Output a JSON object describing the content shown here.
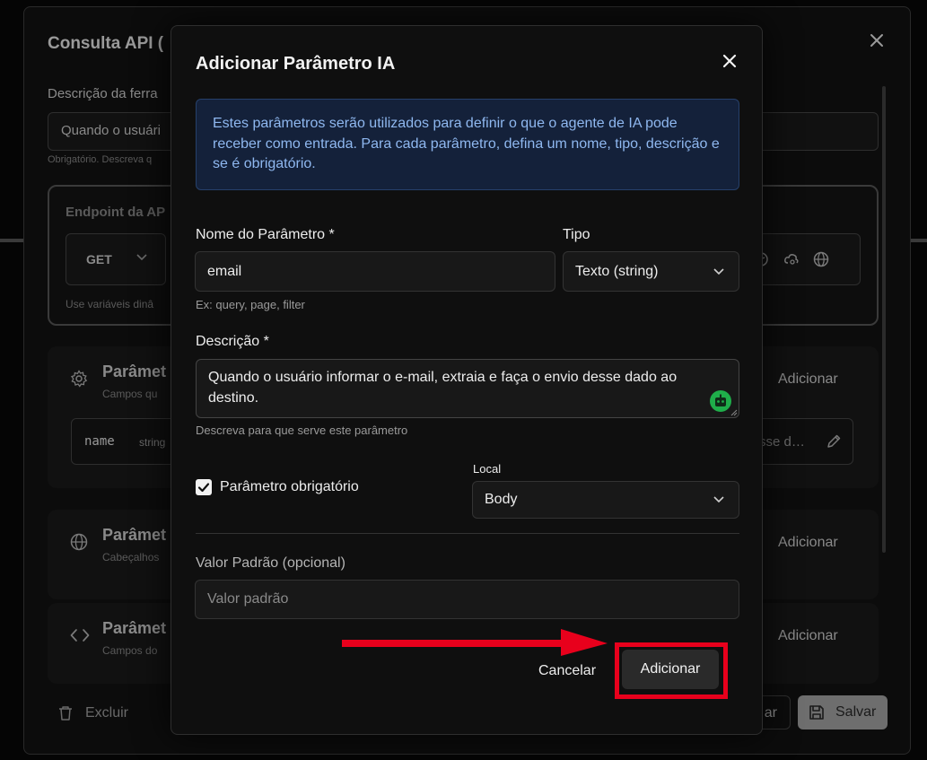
{
  "background_modal": {
    "title": "Consulta API (",
    "description_label": "Descrição da ferra",
    "description_value": "Quando o usuári",
    "description_hint": "Obrigatório. Descreva q",
    "endpoint_title": "Endpoint da AP",
    "method": "GET",
    "endpoint_hint": "Use variáveis dinâ",
    "sections": [
      {
        "title": "Parâmet",
        "subtitle": "Campos qu",
        "add_label": "Adicionar",
        "icon": "gear-icon"
      },
      {
        "title": "Parâmet",
        "subtitle": "Cabeçalhos",
        "add_label": "Adicionar",
        "icon": "globe-icon"
      },
      {
        "title": "Parâmet",
        "subtitle": "Campos do",
        "add_label": "Adicionar",
        "icon": "code-icon"
      }
    ],
    "param_row": {
      "name": "name",
      "type": "string",
      "desc": "sse d…"
    },
    "delete_label": "Excluir",
    "cancel_label": "ar",
    "save_label": "Salvar"
  },
  "dialog": {
    "title": "Adicionar Parâmetro IA",
    "info_text": "Estes parâmetros serão utilizados para definir o que o agente de IA pode receber como entrada. Para cada parâmetro, defina um nome, tipo, descrição e se é obrigatório.",
    "name_label": "Nome do Parâmetro *",
    "name_value": "email",
    "name_hint": "Ex: query, page, filter",
    "type_label": "Tipo",
    "type_value": "Texto (string)",
    "description_label": "Descrição *",
    "description_value": "Quando o usuário informar o e-mail, extraia e faça o envio desse dado ao destino.",
    "description_hint": "Descreva para que serve este parâmetro",
    "required_label": "Parâmetro obrigatório",
    "required_checked": true,
    "local_label": "Local",
    "local_value": "Body",
    "default_label": "Valor Padrão (opcional)",
    "default_placeholder": "Valor padrão",
    "cancel_label": "Cancelar",
    "add_label": "Adicionar"
  },
  "colors": {
    "info_bg": "#14213a",
    "info_text": "#8fb8f0",
    "highlight": "#e8001c",
    "ai_badge": "#1fae4a"
  }
}
